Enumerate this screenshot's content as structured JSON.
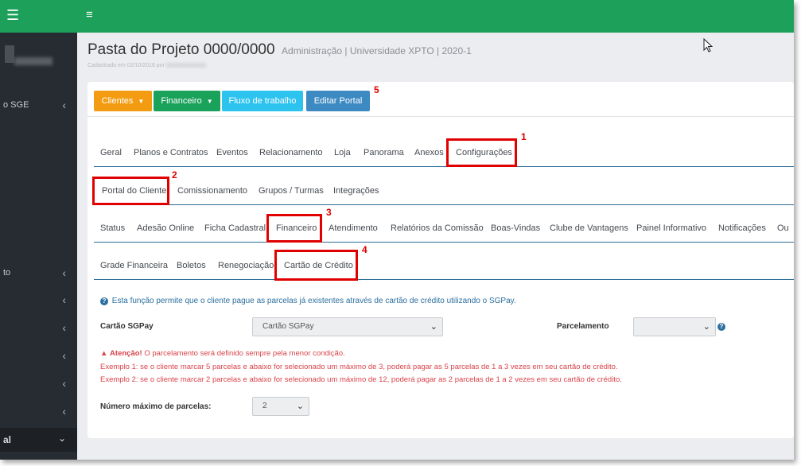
{
  "sidebar": {
    "items": [
      {
        "label": "o SGE",
        "chevron": "‹"
      },
      {
        "label": "to",
        "chevron": "‹"
      },
      {
        "label": "",
        "chevron": "‹"
      },
      {
        "label": "",
        "chevron": "‹"
      },
      {
        "label": "",
        "chevron": "‹"
      },
      {
        "label": "",
        "chevron": "‹"
      },
      {
        "label": "",
        "chevron": "‹"
      }
    ],
    "active": {
      "label": "al",
      "chevron": "⌄"
    }
  },
  "header": {
    "title": "Pasta do Projeto 0000/0000",
    "subtitle": "Administração | Universidade XPTO | 2020-1",
    "registered": "Cadastrado em 02/10/2016 por"
  },
  "toolbar": {
    "clientes": "Clientes",
    "financeiro": "Financeiro",
    "fluxo": "Fluxo de trabalho",
    "editar": "Editar Portal",
    "colors": {
      "clientes": "#f39c12",
      "financeiro": "#1aa15a",
      "fluxo": "#2cc3ef",
      "editar": "#3d8ac2"
    }
  },
  "tabs_main": [
    "Geral",
    "Planos e Contratos",
    "Eventos",
    "Relacionamento",
    "Loja",
    "Panorama",
    "Anexos",
    "Configurações"
  ],
  "tabs_config": [
    "Portal do Cliente",
    "Comissionamento",
    "Grupos / Turmas",
    "Integrações"
  ],
  "tabs_portal": [
    "Status",
    "Adesão Online",
    "Ficha Cadastral",
    "Financeiro",
    "Atendimento",
    "Relatórios da Comissão",
    "Boas-Vindas",
    "Clube de Vantagens",
    "Painel Informativo",
    "Notificações",
    "Ou"
  ],
  "tabs_fin": [
    "Grade Financeira",
    "Boletos",
    "Renegociação",
    "Cartão de Crédito"
  ],
  "annotations": [
    "1",
    "2",
    "3",
    "4",
    "5"
  ],
  "form": {
    "info": "Esta função permite que o cliente pague as parcelas já existentes através de cartão de crédito utilizando o SGPay.",
    "cartao_label": "Cartão SGPay",
    "cartao_value": "Cartão SGPay",
    "parcelamento_label": "Parcelamento",
    "parcelamento_value": "",
    "warn_title": "Atenção!",
    "warn_text": " O parcelamento será definido sempre pela menor condição.",
    "example1": "Exemplo 1: se o cliente marcar 5 parcelas e abaixo for selecionado um máximo de 3, poderá pagar as 5 parcelas de 1 a 3 vezes em seu cartão de crédito.",
    "example2": "Exemplo 2: se o cliente marcar 2 parcelas e abaixo for selecionado um máximo de 12, poderá pagar as 2 parcelas de 1 a 2 vezes em seu cartão de crédito.",
    "max_label": "Número máximo de parcelas:",
    "max_value": "2"
  },
  "colors": {
    "topbar": "#1da15a",
    "sidebar": "#272c33",
    "highlight": "#e00000",
    "tab_line": "#2b6c97",
    "warning": "#d9434a",
    "info": "#2a6f9e"
  }
}
